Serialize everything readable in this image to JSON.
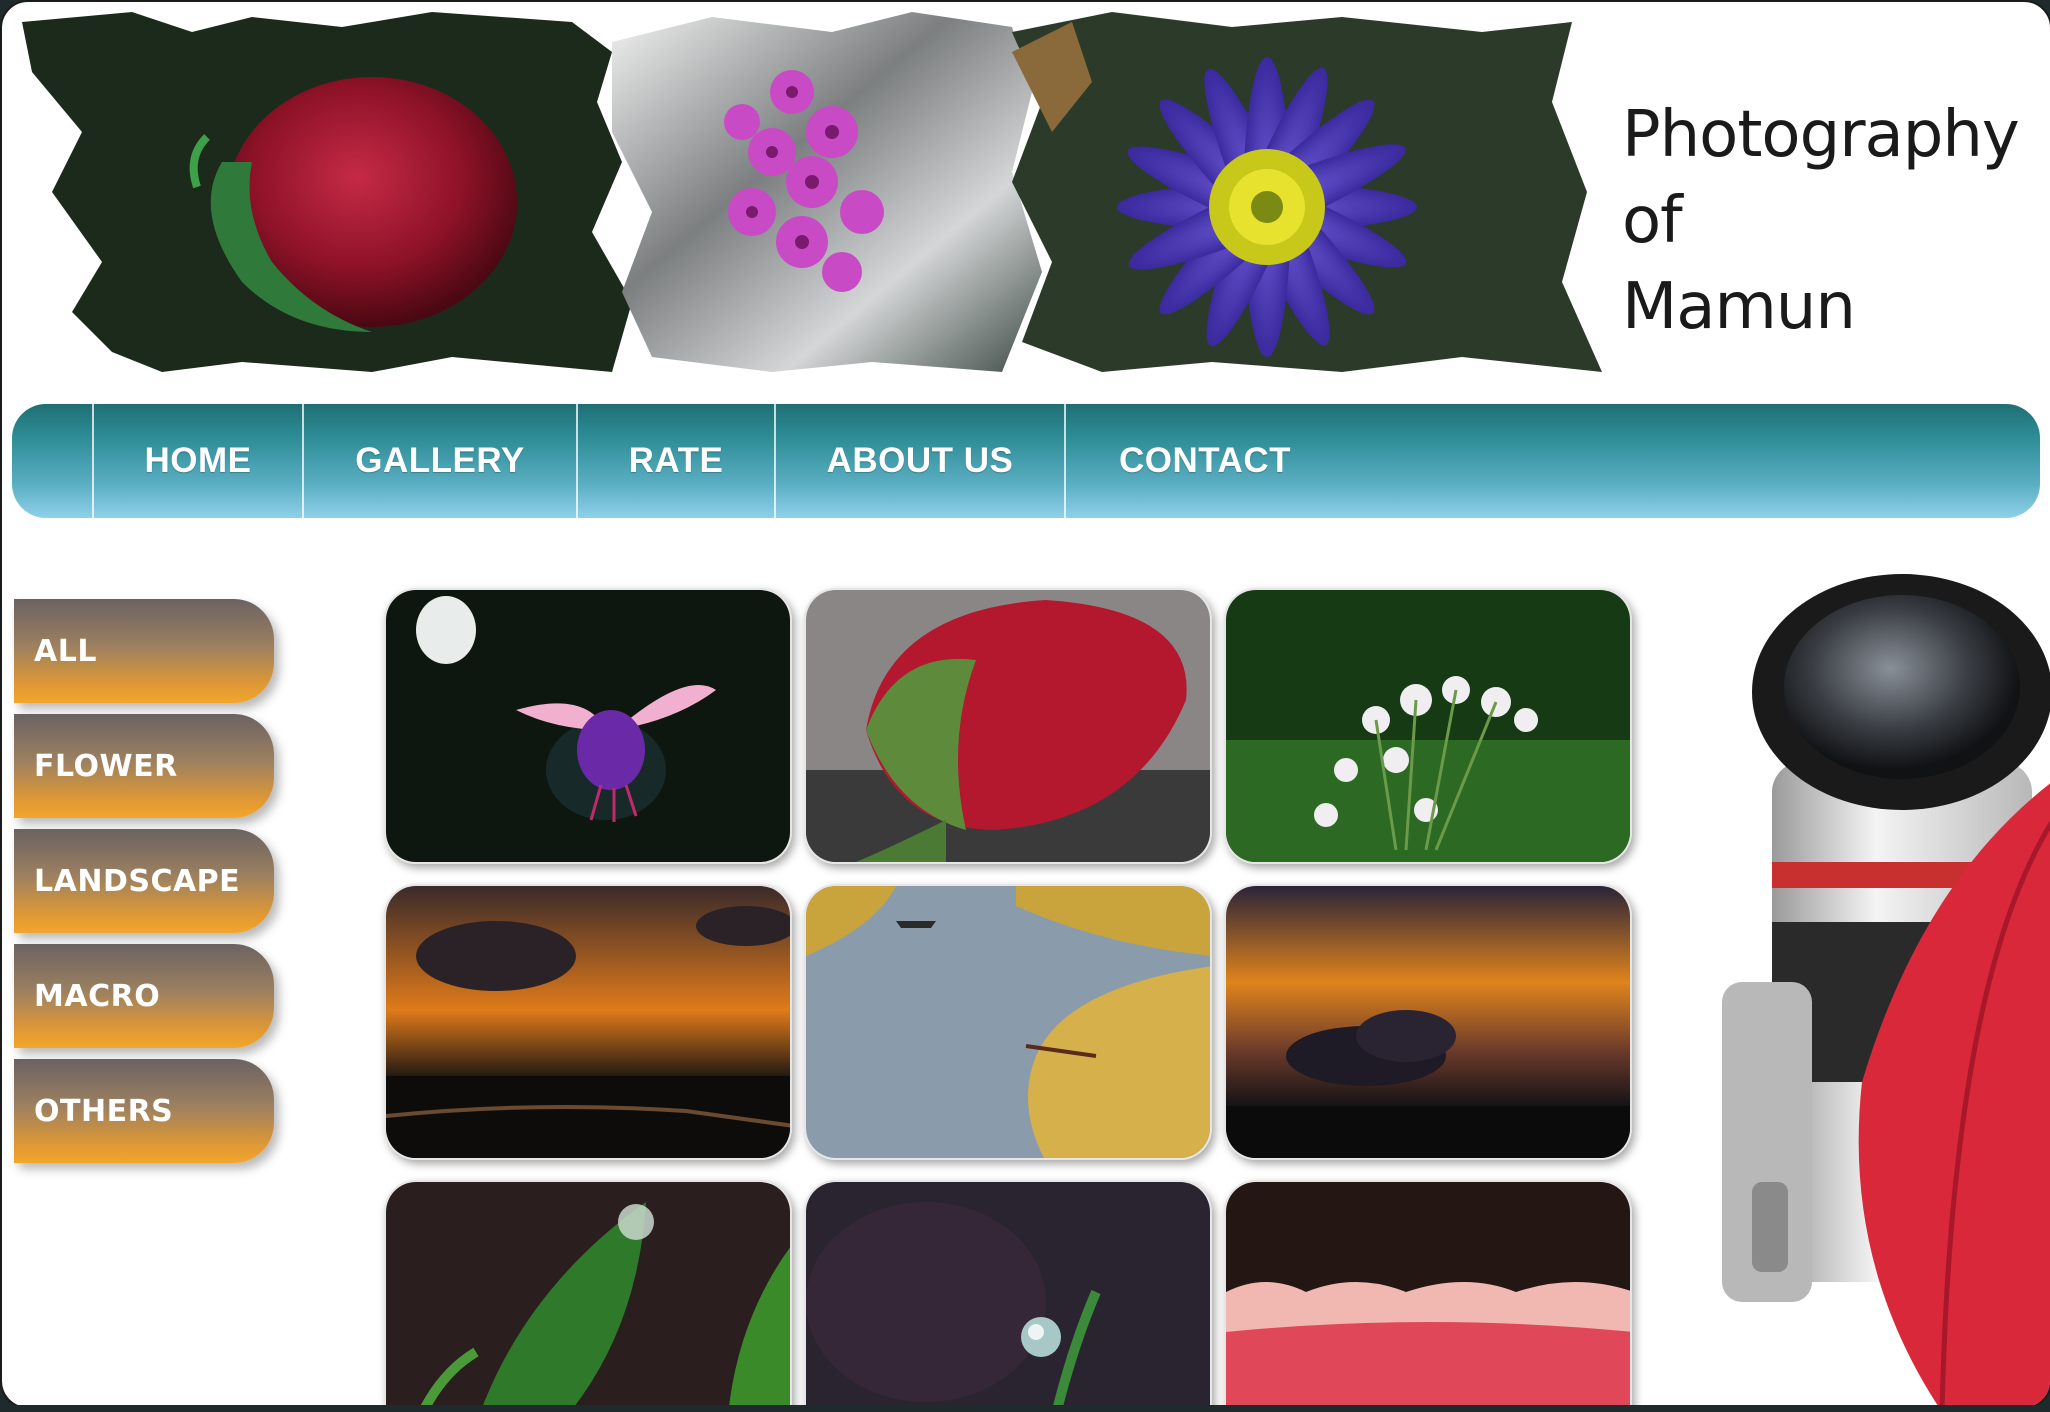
{
  "site": {
    "title_lines": [
      "Photography",
      "of",
      "Mamun"
    ]
  },
  "nav": {
    "items": [
      {
        "label": "HOME"
      },
      {
        "label": "GALLERY"
      },
      {
        "label": "RATE"
      },
      {
        "label": "ABOUT US"
      },
      {
        "label": "CONTACT"
      }
    ]
  },
  "categories": {
    "items": [
      {
        "label": "ALL"
      },
      {
        "label": "FLOWER"
      },
      {
        "label": "LANDSCAPE"
      },
      {
        "label": "MACRO"
      },
      {
        "label": "OTHERS"
      }
    ]
  },
  "gallery": {
    "thumbnails": [
      {
        "subject": "fuchsia-flower"
      },
      {
        "subject": "red-rosebud-with-dew"
      },
      {
        "subject": "white-wildflowers"
      },
      {
        "subject": "orange-sunset-clouds"
      },
      {
        "subject": "river-with-boat"
      },
      {
        "subject": "sunset-over-horizon"
      },
      {
        "subject": "leaf-with-water-drop"
      },
      {
        "subject": "water-drop-on-grass"
      },
      {
        "subject": "red-petal-macro"
      }
    ]
  },
  "colors": {
    "nav_top": "#1f6f74",
    "nav_bottom": "#8fd0ea",
    "category_top": "#6a6262",
    "category_bottom": "#f2a62c",
    "page_background": "#ffffff"
  }
}
